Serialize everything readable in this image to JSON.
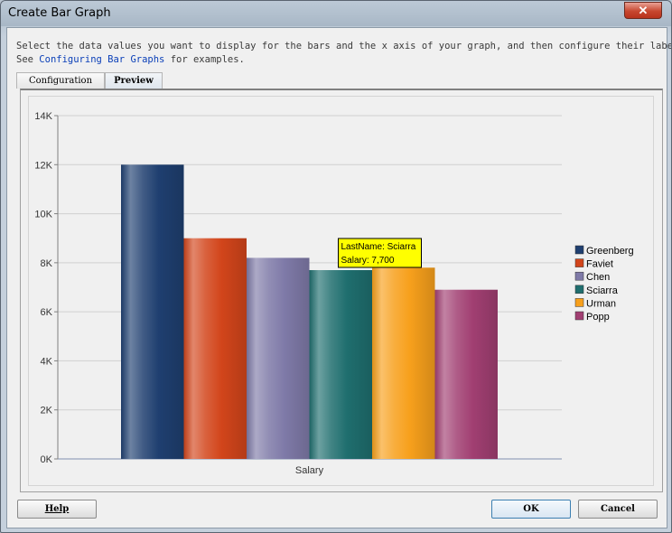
{
  "window": {
    "title": "Create Bar Graph",
    "close_glyph": "✕"
  },
  "instructions": {
    "line1": "Select the data values you want to display for the bars and the x axis of your graph, and then configure their labels.",
    "line2_prefix": "See ",
    "link": "Configuring Bar Graphs",
    "line2_suffix": " for examples."
  },
  "tabs": [
    {
      "label": "Configuration",
      "active": false
    },
    {
      "label": "Preview",
      "active": true
    }
  ],
  "tooltip": {
    "line1": "LastName: Sciarra",
    "line2": "Salary: 7,700"
  },
  "buttons": {
    "help": "Help",
    "ok": "OK",
    "cancel": "Cancel"
  },
  "colors": {
    "greenberg": "#1f3f70",
    "faviet": "#d2451b",
    "chen": "#7f7aa8",
    "sciarra": "#1f6e6e",
    "urman": "#f7a01c",
    "popp": "#a13f72",
    "tooltip_bg": "#ffff00"
  },
  "chart_data": {
    "type": "bar",
    "categories": [
      "Salary"
    ],
    "xlabel": "Salary",
    "ylim": [
      0,
      14000
    ],
    "yticks": [
      0,
      2000,
      4000,
      6000,
      8000,
      10000,
      12000,
      14000
    ],
    "ytick_labels": [
      "0K",
      "2K",
      "4K",
      "6K",
      "8K",
      "10K",
      "12K",
      "14K"
    ],
    "grid": true,
    "legend_position": "right",
    "series": [
      {
        "name": "Greenberg",
        "values": [
          12000
        ],
        "color": "#1f3f70"
      },
      {
        "name": "Faviet",
        "values": [
          9000
        ],
        "color": "#d2451b"
      },
      {
        "name": "Chen",
        "values": [
          8200
        ],
        "color": "#7f7aa8"
      },
      {
        "name": "Sciarra",
        "values": [
          7700
        ],
        "color": "#1f6e6e"
      },
      {
        "name": "Urman",
        "values": [
          7800
        ],
        "color": "#f7a01c"
      },
      {
        "name": "Popp",
        "values": [
          6900
        ],
        "color": "#a13f72"
      }
    ]
  }
}
